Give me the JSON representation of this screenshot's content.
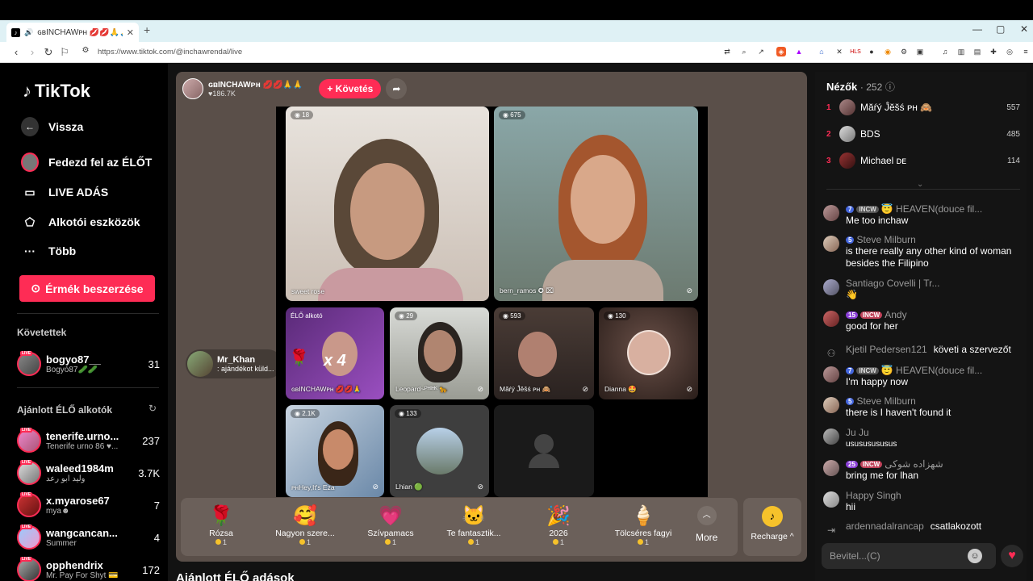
{
  "browser": {
    "tab_title": "ɢʙINCHAWᴘʜ 💋💋🙏🙏 @",
    "url": "https://www.tiktok.com/@inchawrendal/live"
  },
  "sidebar": {
    "logo": "TikTok",
    "back": "Vissza",
    "nav": [
      "Fedezd fel az ÉLŐT",
      "LIVE ADÁS",
      "Alkotói eszközök",
      "Több"
    ],
    "coins_button": "Érmék beszerzése",
    "following_title": "Követettek",
    "following": [
      {
        "name": "bogyo87__",
        "sub": "Bogyó87🥒🥒",
        "count": "31"
      }
    ],
    "recommended_title": "Ajánlott ÉLŐ alkotók",
    "recommended": [
      {
        "name": "tenerife.urno...",
        "sub": "Tenerife urno 86 ♥...",
        "count": "237"
      },
      {
        "name": "waleed1984m",
        "sub": "وليد ابو رعد",
        "count": "3.7K"
      },
      {
        "name": "x.myarose67",
        "sub": "mya☻",
        "count": "7"
      },
      {
        "name": "wangcancan...",
        "sub": "Summer",
        "count": "4"
      },
      {
        "name": "opphendrix",
        "sub": "Mr. Pay For Shyt 💳",
        "count": "172"
      }
    ]
  },
  "stream": {
    "host_name": "ɢʙINCHAWᴘʜ 💋💋🙏🙏",
    "host_likes": "♥186.7K",
    "follow": "+ Követés",
    "cells": [
      {
        "count": "18",
        "label": "sweet rose"
      },
      {
        "count": "675",
        "label": "bern_ramos ✪ ⌧"
      },
      {
        "count": "",
        "label": "ɢʙINCHAWᴘʜ 💋💋🙏",
        "tag": "ÉLŐ alkotó",
        "combo": "x 4"
      },
      {
        "count": "29",
        "label": "Leopard~ᴾᴴᴵᴴᴷ 🐆"
      },
      {
        "count": "593",
        "label": "Măŕý Ĵĕšś ᴘʜ 🙈"
      },
      {
        "count": "130",
        "label": "Dianna 🤩"
      },
      {
        "count": "2.1K",
        "label": "ᴘʜHey,It's Eza"
      },
      {
        "count": "133",
        "label": "Lhian 🟢"
      }
    ],
    "gifter": {
      "name": "Mr_Khan",
      "text": ": ajándékot küld..."
    },
    "gifts": [
      {
        "name": "Rózsa",
        "price": "1",
        "icon": "🌹"
      },
      {
        "name": "Nagyon szere...",
        "price": "1",
        "icon": "🥰"
      },
      {
        "name": "Szívpamacs",
        "price": "1",
        "icon": "💗"
      },
      {
        "name": "Te fantasztik...",
        "price": "1",
        "icon": "🐱"
      },
      {
        "name": "2026",
        "price": "1",
        "icon": "🎉"
      },
      {
        "name": "Tölcséres fagyi",
        "price": "1",
        "icon": "🍦"
      }
    ],
    "more": "More",
    "recharge": "Recharge ^",
    "bottom_title": "Ajánlott ÉLŐ adások"
  },
  "panel": {
    "viewers_title": "Nézők",
    "viewers_count": "· 252",
    "viewers": [
      {
        "rank": "1",
        "name": "Măŕý Ĵĕšś ᴘʜ 🙈",
        "count": "557"
      },
      {
        "rank": "2",
        "name": "BDS",
        "count": "485"
      },
      {
        "rank": "3",
        "name": "Michael ᴅᴇ",
        "count": "114"
      }
    ],
    "messages": [
      {
        "level": "7",
        "fan": "INCW",
        "user": "😇 HEAVEN(douce fil...",
        "text": "Me too inchaw"
      },
      {
        "level": "5",
        "fan": "",
        "user": "Steve Milburn",
        "text": "is there really any other kind of woman besides the Filipino"
      },
      {
        "level": "",
        "fan": "",
        "user": "Santiago Covelli | Tr...",
        "text": "👋"
      },
      {
        "level": "15",
        "fan": "INCW",
        "user": "Andy",
        "text": "good for her"
      },
      {
        "level": "",
        "fan": "",
        "user": "Kjetil Pedersen121",
        "text": "",
        "joined": "követi a szervezőt"
      },
      {
        "level": "7",
        "fan": "INCW",
        "user": "😇 HEAVEN(douce fil...",
        "text": "I'm happy now"
      },
      {
        "level": "5",
        "fan": "",
        "user": "Steve Milburn",
        "text": "there is I haven't found it"
      },
      {
        "level": "",
        "fan": "",
        "user": "Ju Ju",
        "text": "usususususus"
      },
      {
        "level": "25",
        "fan": "INCW",
        "user": "شهزاده شوکی",
        "text": "bring me for lhan"
      },
      {
        "level": "",
        "fan": "",
        "user": "Happy Singh",
        "text": "hii"
      },
      {
        "level": "",
        "fan": "",
        "user": "ardennadalrancap",
        "text": "",
        "joined": "csatlakozott"
      }
    ],
    "input_placeholder": "Bevitel...(C)"
  }
}
